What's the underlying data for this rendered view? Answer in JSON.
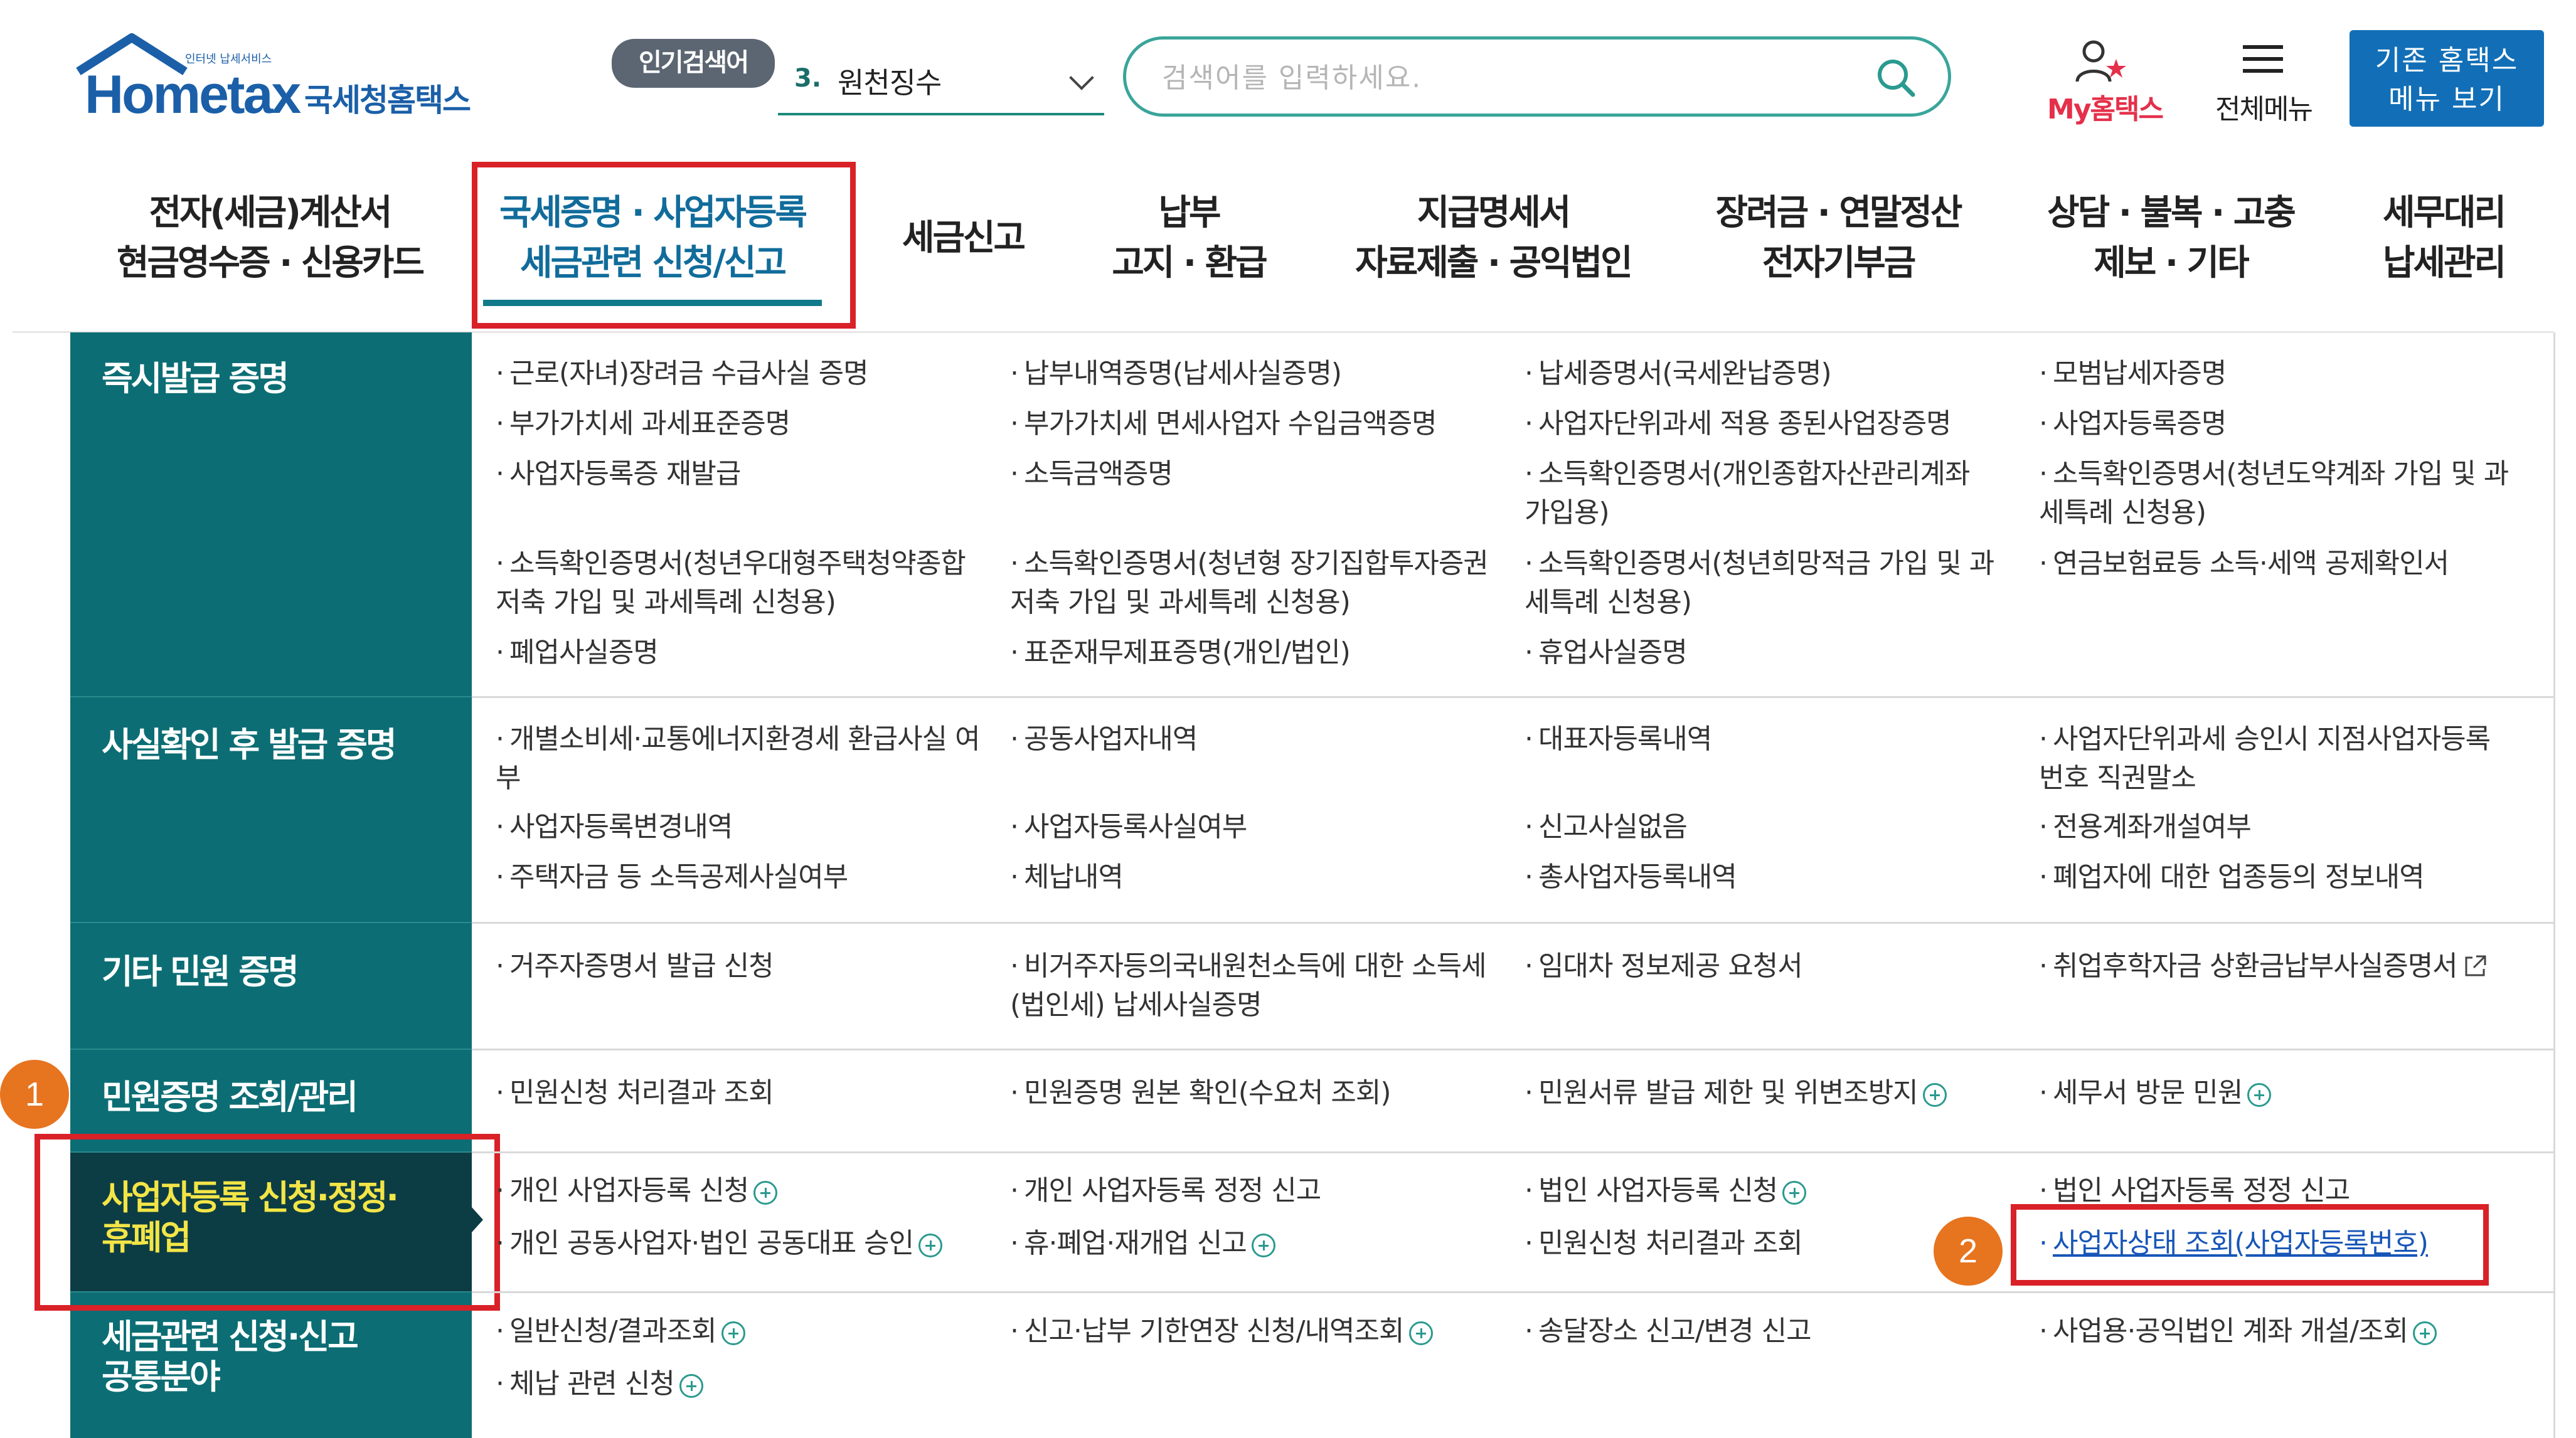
{
  "header": {
    "logo_tiny": "인터넷 납세서비스",
    "logo_word": "Hometax",
    "logo_kr": "국세청홈택스",
    "popular_badge": "인기검색어",
    "popular_num": "3.",
    "popular_text": "원천징수",
    "search_placeholder": "검색어를 입력하세요.",
    "my_home": "My홈택스",
    "all_menu": "전체메뉴",
    "old_menu_line1": "기존 홈택스",
    "old_menu_line2": "메뉴 보기"
  },
  "nav": [
    {
      "l1": "전자(세금)계산서",
      "l2": "현금영수증 · 신용카드"
    },
    {
      "l1": "국세증명 · 사업자등록",
      "l2": "세금관련 신청/신고"
    },
    {
      "l1": "세금신고",
      "l2": ""
    },
    {
      "l1": "납부",
      "l2": "고지 · 환급"
    },
    {
      "l1": "지급명세서",
      "l2": "자료제출 · 공익법인"
    },
    {
      "l1": "장려금 · 연말정산",
      "l2": "전자기부금"
    },
    {
      "l1": "상담 · 불복 · 고충",
      "l2": "제보 · 기타"
    },
    {
      "l1": "세무대리",
      "l2": "납세관리"
    }
  ],
  "sidebar": [
    {
      "l1": "즉시발급 증명",
      "l2": ""
    },
    {
      "l1": "사실확인 후 발급 증명",
      "l2": ""
    },
    {
      "l1": "기타 민원 증명",
      "l2": ""
    },
    {
      "l1": "민원증명 조회/관리",
      "l2": ""
    },
    {
      "l1": "사업자등록 신청·정정·",
      "l2": "휴폐업"
    },
    {
      "l1": "세금관련 신청·신고",
      "l2": "공통분야"
    }
  ],
  "items": {
    "r1": [
      "근로(자녀)장려금 수급사실 증명",
      "납부내역증명(납세사실증명)",
      "납세증명서(국세완납증명)",
      "모범납세자증명",
      "부가가치세 과세표준증명",
      "부가가치세 면세사업자 수입금액증명",
      "사업자단위과세 적용 종된사업장증명",
      "사업자등록증명",
      "사업자등록증 재발급",
      "소득금액증명",
      "소득확인증명서(개인종합자산관리계좌 가입용)",
      "소득확인증명서(청년도약계좌 가입 및 과세특례 신청용)",
      "소득확인증명서(청년우대형주택청약종합저축 가입 및 과세특례 신청용)",
      "소득확인증명서(청년형 장기집합투자증권저축 가입 및 과세특례 신청용)",
      "소득확인증명서(청년희망적금 가입 및 과세특례 신청용)",
      "연금보험료등 소득·세액 공제확인서",
      "폐업사실증명",
      "표준재무제표증명(개인/법인)",
      "휴업사실증명"
    ],
    "r2": [
      "개별소비세·교통에너지환경세 환급사실 여부",
      "공동사업자내역",
      "대표자등록내역",
      "사업자단위과세 승인시 지점사업자등록 번호 직권말소",
      "사업자등록변경내역",
      "사업자등록사실여부",
      "신고사실없음",
      "전용계좌개설여부",
      "주택자금 등 소득공제사실여부",
      "체납내역",
      "총사업자등록내역",
      "폐업자에 대한 업종등의 정보내역"
    ],
    "r3": [
      "거주자증명서 발급 신청",
      "비거주자등의국내원천소득에 대한 소득세(법인세) 납세사실증명",
      "임대차 정보제공 요청서",
      "취업후학자금 상환금납부사실증명서"
    ],
    "r4": [
      "민원신청 처리결과 조회",
      "민원증명 원본 확인(수요처 조회)",
      "민원서류 발급 제한 및 위변조방지",
      "세무서 방문 민원"
    ],
    "r5": [
      "개인 사업자등록 신청",
      "개인 사업자등록 정정 신고",
      "법인 사업자등록 신청",
      "법인 사업자등록 정정 신고",
      "개인 공동사업자·법인 공동대표 승인",
      "휴·폐업·재개업 신고",
      "민원신청 처리결과 조회",
      "사업자상태 조회(사업자등록번호)"
    ],
    "r6": [
      "일반신청/결과조회",
      "신고·납부 기한연장 신청/내역조회",
      "송달장소 신고/변경 신고",
      "사업용·공익법인 계좌 개설/조회",
      "체납 관련 신청"
    ]
  },
  "markers": [
    "1",
    "2"
  ],
  "colors": {
    "brand_blue": "#1b5fa8",
    "sidebar_teal": "#0c6e74",
    "highlight_red": "#d92128",
    "marker_orange": "#e7741f",
    "link_blue": "#1856b8"
  }
}
